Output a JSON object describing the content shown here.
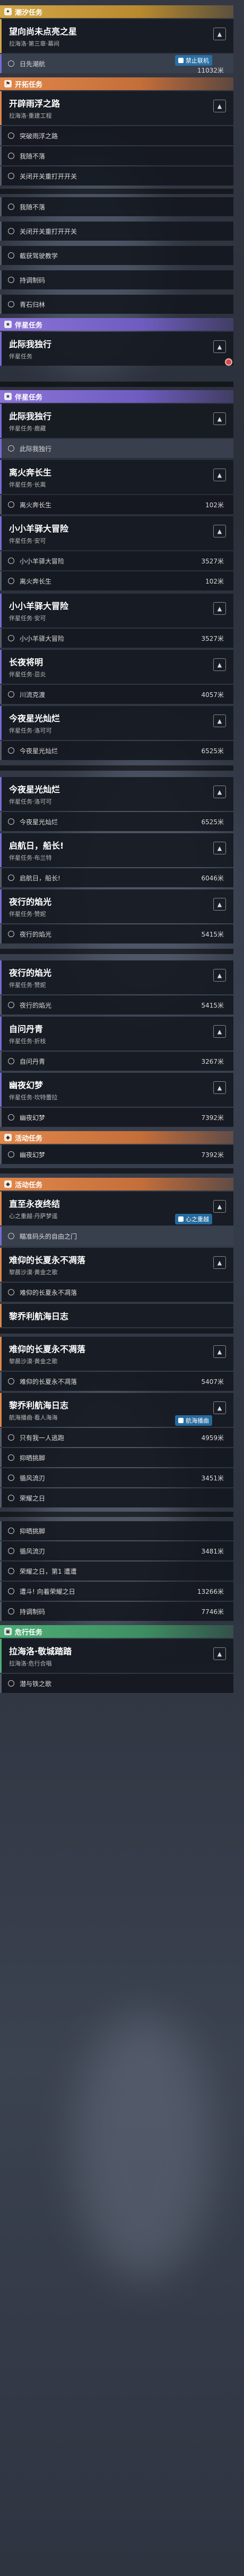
{
  "sections": {
    "explore": "潮汐任务",
    "open": "开拓任务",
    "companion": "伴星任务",
    "event": "活动任务",
    "daily": "危行任务"
  },
  "cards": {
    "c1": {
      "title": "望向尚未点亮之星",
      "sub": "拉海洛·第三章·幕间"
    },
    "c2": {
      "title": "开辟雨浮之路",
      "sub": "拉海洛·重建工程"
    },
    "c3": {
      "title": "此际我独行",
      "sub": "伴星任务"
    },
    "c4": {
      "title": "此际我独行",
      "sub": "伴星任务·鹿藏"
    },
    "c5": {
      "title": "离火奔长生",
      "sub": "伴星任务·长离"
    },
    "c6": {
      "title": "小小羊驿大冒险",
      "sub": "伴星任务·安可"
    },
    "c7": {
      "title": "小小羊驿大冒险",
      "sub": "伴星任务·安可"
    },
    "c8": {
      "title": "长夜将明",
      "sub": "伴星任务·忌炎"
    },
    "c9": {
      "title": "今夜星光灿烂",
      "sub": "伴星任务·洛可可"
    },
    "c10": {
      "title": "今夜星光灿烂",
      "sub": "伴星任务·洛可可"
    },
    "c11": {
      "title": "启航日，船长!",
      "sub": "伴星任务·布兰特"
    },
    "c12": {
      "title": "夜行的焰光",
      "sub": "伴星任务·赞妮"
    },
    "c13": {
      "title": "夜行的焰光",
      "sub": "伴星任务·赞妮"
    },
    "c14": {
      "title": "自问丹青",
      "sub": "伴星任务·折枝"
    },
    "c15": {
      "title": "幽夜幻梦",
      "sub": "伴星任务·坎特蕾拉"
    },
    "c16": {
      "title": "直至永夜终结",
      "sub": "心之重越·丹萨梦遥"
    },
    "c17": {
      "title": "难仰的长夏永不凋落",
      "sub": "黎晨沙漠·黄金之歌"
    },
    "c18": {
      "title": "黎乔利航海日志",
      "sub": ""
    },
    "c19": {
      "title": "难仰的长夏永不凋落",
      "sub": "黎晨沙漠·黄金之歌"
    },
    "c20": {
      "title": "黎乔利航海日志",
      "sub": "航海播曲·看人海海"
    },
    "c21": {
      "title": "拉海洛·敬城踏踏",
      "sub": "拉海洛·危行合唱"
    }
  },
  "rows": {
    "r1": {
      "label": "日先潮航",
      "dist": "11032米"
    },
    "r2": {
      "label": "突破雨浮之路",
      "dist": ""
    },
    "r3": {
      "label": "我随不落",
      "dist": ""
    },
    "r4": {
      "label": "关闭开关重打开开关",
      "dist": ""
    },
    "r5": {
      "label": "我随不落",
      "dist": ""
    },
    "r6": {
      "label": "关闭开关重打开开关",
      "dist": ""
    },
    "r7": {
      "label": "截获驾驶教学",
      "dist": ""
    },
    "r8": {
      "label": "持调制码",
      "dist": ""
    },
    "r9": {
      "label": "青石归林",
      "dist": ""
    },
    "r10": {
      "label": "此际我独行",
      "dist": ""
    },
    "r11": {
      "label": "离火奔长生",
      "dist": "102米"
    },
    "r12": {
      "label": "离火奔长生",
      "dist": "102米"
    },
    "r13": {
      "label": "小小羊驿大冒险",
      "dist": "3527米"
    },
    "r14": {
      "label": "离火奔长生",
      "dist": "102米"
    },
    "r15": {
      "label": "小小羊驿大冒险",
      "dist": "3527米"
    },
    "r16": {
      "label": "川流克渡",
      "dist": "4057米"
    },
    "r17": {
      "label": "今夜星光灿烂",
      "dist": "6525米"
    },
    "r18": {
      "label": "今夜星光灿烂",
      "dist": "6525米"
    },
    "r19": {
      "label": "启航日，船长!",
      "dist": "6046米"
    },
    "r20": {
      "label": "夜行的焰光",
      "dist": "5415米"
    },
    "r21": {
      "label": "夜行的焰光",
      "dist": "5415米"
    },
    "r22": {
      "label": "自问丹青",
      "dist": "3267米"
    },
    "r23": {
      "label": "幽夜幻梦",
      "dist": "7392米"
    },
    "r24": {
      "label": "幽夜幻梦",
      "dist": "7392米"
    },
    "r25": {
      "label": "瞄准码头的自由之门",
      "dist": ""
    },
    "r26": {
      "label": "难仰的长夏永不凋落",
      "dist": ""
    },
    "r27": {
      "label": "难仰的长夏永不凋落",
      "dist": "5407米"
    },
    "r28": {
      "label": "只有我一人逃跑",
      "dist": "4959米"
    },
    "r29": {
      "label": "抑晒挑脚",
      "dist": ""
    },
    "r30": {
      "label": "循风流刃",
      "dist": "3451米"
    },
    "r31": {
      "label": "荣耀之日",
      "dist": ""
    },
    "r32": {
      "label": "抑晒挑脚",
      "dist": ""
    },
    "r33": {
      "label": "循风流刃",
      "dist": "3481米"
    },
    "r34": {
      "label": "荣耀之日，第1 遭遭",
      "dist": ""
    },
    "r35": {
      "label": "遭斗! 向着荣耀之日",
      "dist": "13266米"
    },
    "r36": {
      "label": "持调制码",
      "dist": "7746米"
    },
    "r37": {
      "label": "潜与铁之歌",
      "dist": ""
    }
  },
  "badges": {
    "b1": "禁止联机",
    "b2": "心之重越",
    "b3": "航海播曲"
  },
  "colors": {
    "purple": "#8b73d6",
    "orange": "#e0874a",
    "gold": "#d3a646",
    "green": "#4fae78"
  }
}
